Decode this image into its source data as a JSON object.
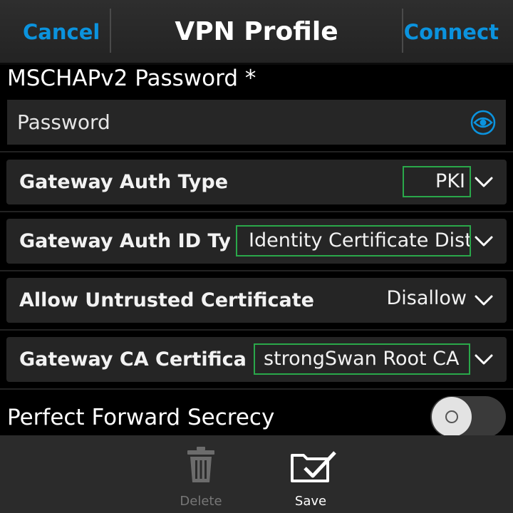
{
  "titlebar": {
    "cancel_label": "Cancel",
    "title": "VPN Profile",
    "connect_label": "Connect"
  },
  "password": {
    "label": "MSCHAPv2 Password *",
    "placeholder": "Password",
    "value": "",
    "visibility_icon": "eye-icon"
  },
  "fields": [
    {
      "label": "Gateway Auth Type",
      "value": "PKI",
      "highlighted": true
    },
    {
      "label": "Gateway Auth ID Type",
      "value": "Identity Certificate Distinguished Name",
      "highlighted": true
    },
    {
      "label": "Allow Untrusted Certificate",
      "value": "Disallow",
      "highlighted": false
    },
    {
      "label": "Gateway CA Certificate",
      "value": "strongSwan Root CA",
      "highlighted": true
    }
  ],
  "pfs": {
    "label": "Perfect Forward Secrecy",
    "enabled": false
  },
  "actions": {
    "delete_label": "Delete",
    "delete_icon": "trash-icon",
    "save_label": "Save",
    "save_icon": "folder-check-icon"
  },
  "colors": {
    "accent": "#0b93de",
    "highlight_border": "#2aa84a",
    "background": "#000000",
    "row_background": "#252525",
    "action_bar": "#2b2b2b"
  }
}
